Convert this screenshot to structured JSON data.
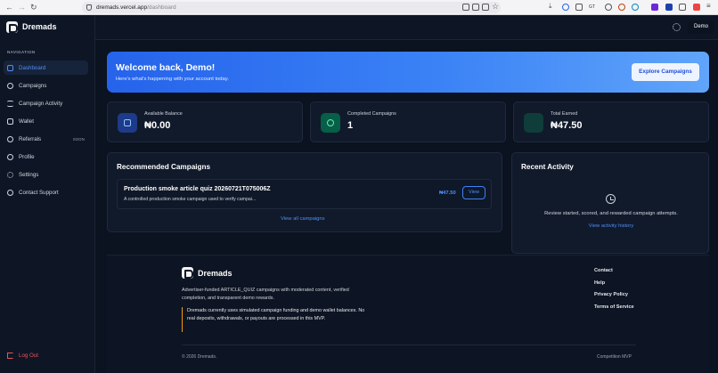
{
  "browser": {
    "url_host": "dremads.vercel.app",
    "url_path": "/dashboard",
    "back": "←",
    "forward": "→",
    "reload": "↻"
  },
  "sidebar": {
    "brand": "Dremads",
    "heading": "NAVIGATION",
    "items": [
      {
        "label": "Dashboard",
        "icon": "dashboard-icon"
      },
      {
        "label": "Campaigns",
        "icon": "compass-icon"
      },
      {
        "label": "Campaign Activity",
        "icon": "list-icon"
      },
      {
        "label": "Wallet",
        "icon": "wallet-icon"
      },
      {
        "label": "Referrals",
        "icon": "users-icon",
        "badge": "SOON"
      },
      {
        "label": "Profile",
        "icon": "user-icon"
      },
      {
        "label": "Settings",
        "icon": "gear-icon"
      },
      {
        "label": "Contact Support",
        "icon": "support-icon"
      }
    ],
    "logout": "Log Out"
  },
  "topbar": {
    "user": "Demo"
  },
  "hero": {
    "title": "Welcome back, Demo!",
    "subtitle": "Here's what's happening with your account today.",
    "button": "Explore Campaigns"
  },
  "stats": [
    {
      "label": "Available Balance",
      "value": "₦0.00",
      "color": "#1e3a8a"
    },
    {
      "label": "Completed Campaigns",
      "value": "1",
      "color": "#065f46"
    },
    {
      "label": "Total Earned",
      "value": "₦47.50",
      "color": "#0f3d3a"
    }
  ],
  "recommended": {
    "title": "Recommended Campaigns",
    "campaign": {
      "title": "Production smoke article quiz 20260721T075006Z",
      "description": "A controlled production smoke campaign used to verify campai...",
      "price": "₦47.50",
      "button": "View"
    },
    "view_all": "View all campaigns"
  },
  "activity": {
    "title": "Recent Activity",
    "empty": "Review started, scored, and rewarded campaign attempts.",
    "link": "View activity history"
  },
  "footer": {
    "brand": "Dremads",
    "description": "Advertiser-funded ARTICLE_QUIZ campaigns with moderated content, verified completion, and transparent demo rewards.",
    "note": "Dremads currently uses simulated campaign funding and demo wallet balances. No real deposits, withdrawals, or payouts are processed in this MVP.",
    "links": [
      "Contact",
      "Help",
      "Privacy Policy",
      "Terms of Service"
    ],
    "copyright": "© 2026 Dremads.",
    "version": "Competition MVP"
  }
}
